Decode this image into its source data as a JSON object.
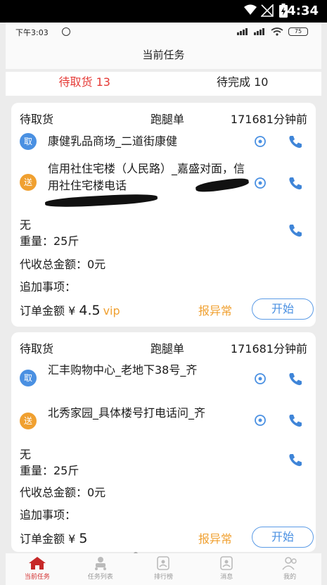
{
  "system": {
    "time": "4:34"
  },
  "inner_status": {
    "time": "下午3:03",
    "battery": "75"
  },
  "header": {
    "title": "当前任务"
  },
  "tabs": [
    {
      "label": "待取货 13",
      "active": true
    },
    {
      "label": "待完成 10",
      "active": false
    }
  ],
  "orders": [
    {
      "status": "待取货",
      "kind": "跑腿单",
      "time_ago": "171681分钟前",
      "pickup_badge": "取",
      "pickup_address": "康健乳品商场_二道街康健",
      "deliver_badge": "送",
      "deliver_address": "信用社住宅楼（人民路）_嘉盛对面，信用社住宅楼电话",
      "item_name": "无",
      "weight": "重量：25斤",
      "cod": "代收总金额：0元",
      "extra": "追加事项：",
      "amount_label": "订单金额 ¥ ",
      "amount": "4.5",
      "vip": "vip",
      "report_label": "报异常",
      "start_label": "开始"
    },
    {
      "status": "待取货",
      "kind": "跑腿单",
      "time_ago": "171681分钟前",
      "pickup_badge": "取",
      "pickup_address": "汇丰购物中心_老地下38号_齐",
      "deliver_badge": "送",
      "deliver_address": "北秀家园_具体楼号打电话问_齐",
      "item_name": "无",
      "weight": "重量：25斤",
      "cod": "代收总金额：0元",
      "extra": "追加事项：",
      "amount_label": "订单金额 ¥ ",
      "amount": "5",
      "report_label": "报异常",
      "start_label": "开始"
    }
  ],
  "bottom_nav": [
    {
      "label": "当前任务",
      "icon": "home-icon",
      "active": true
    },
    {
      "label": "任务列表",
      "icon": "courier-icon",
      "active": false
    },
    {
      "label": "排行榜",
      "icon": "rank-icon",
      "active": false
    },
    {
      "label": "消息",
      "icon": "message-icon",
      "active": false
    },
    {
      "label": "我的",
      "icon": "profile-icon",
      "active": false
    }
  ],
  "colors": {
    "accent_red": "#e53935",
    "blue": "#4a90e2",
    "orange": "#f0a030"
  }
}
